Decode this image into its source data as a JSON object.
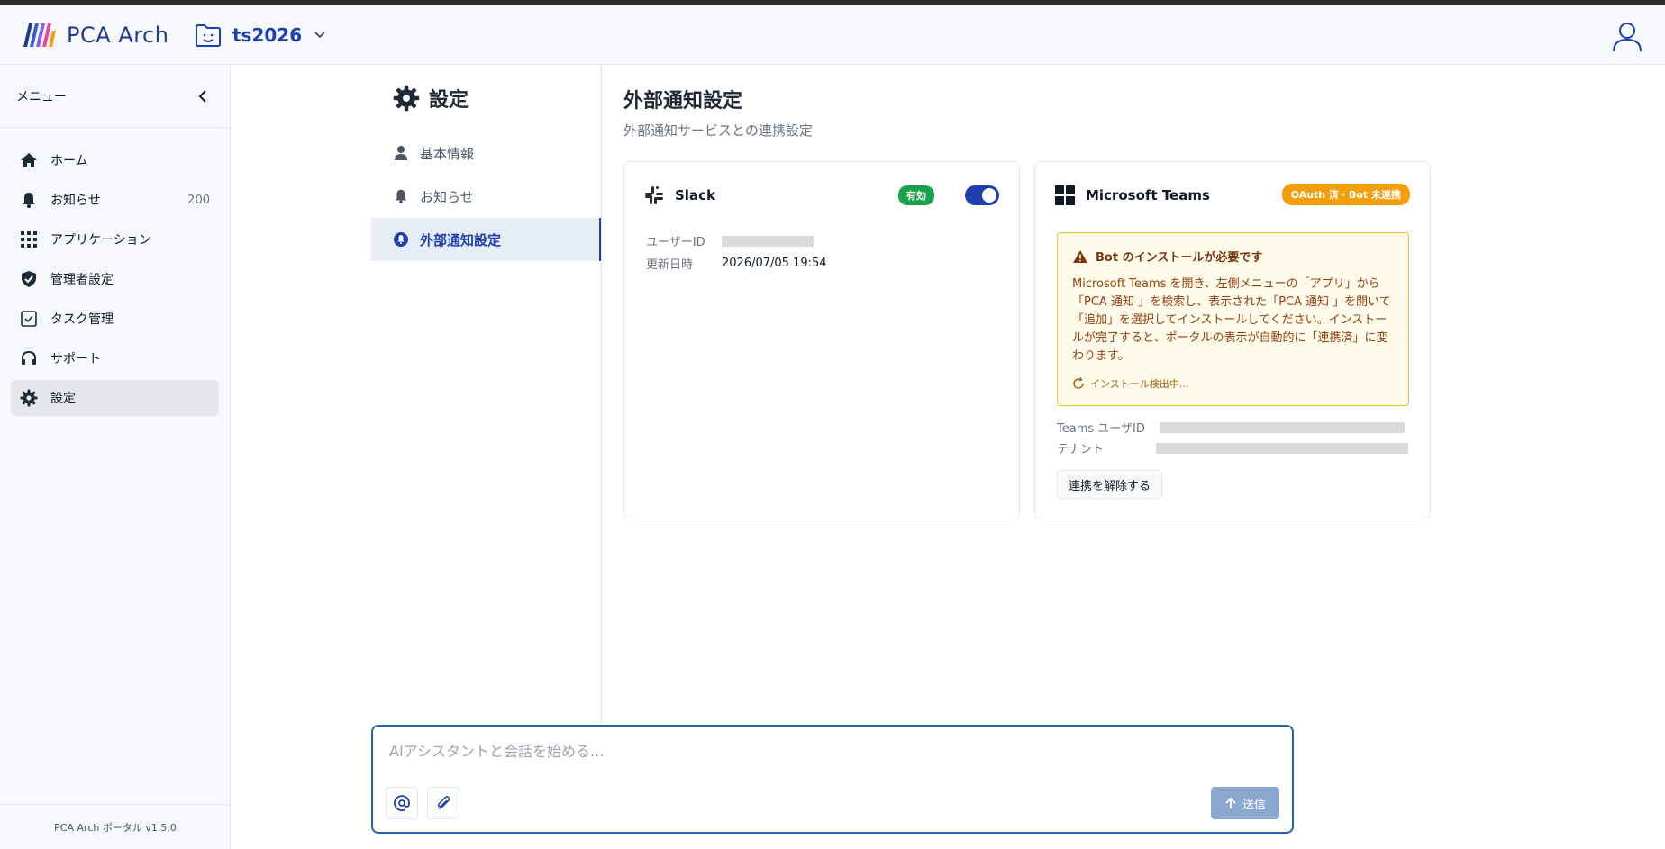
{
  "app": {
    "brand": "PCA Arch",
    "workspace": "ts2026",
    "version_label": "PCA Arch ポータル v1.5.0"
  },
  "sidebar": {
    "title": "メニュー",
    "items": [
      {
        "label": "ホーム",
        "icon": "home-icon"
      },
      {
        "label": "お知らせ",
        "icon": "bell-icon",
        "count": "200"
      },
      {
        "label": "アプリケーション",
        "icon": "grid-icon"
      },
      {
        "label": "管理者設定",
        "icon": "shield-icon"
      },
      {
        "label": "タスク管理",
        "icon": "checkbox-icon"
      },
      {
        "label": "サポート",
        "icon": "headset-icon"
      },
      {
        "label": "設定",
        "icon": "gear-icon",
        "active": true
      }
    ]
  },
  "settings_nav": {
    "title": "設定",
    "items": [
      {
        "label": "基本情報",
        "icon": "person-icon"
      },
      {
        "label": "お知らせ",
        "icon": "bell-icon"
      },
      {
        "label": "外部通知設定",
        "icon": "bell-circle-icon",
        "active": true
      }
    ]
  },
  "page": {
    "title": "外部通知設定",
    "subtitle": "外部通知サービスとの連携設定"
  },
  "slack": {
    "name": "Slack",
    "status_badge": "有効",
    "enabled": true,
    "user_id_label": "ユーザーID",
    "updated_label": "更新日時",
    "updated_value": "2026/07/05 19:54"
  },
  "teams": {
    "name": "Microsoft Teams",
    "status_badge": "OAuth 済・Bot 未連携",
    "warning_title": "Bot のインストールが必要です",
    "warning_body": "Microsoft Teams を開き、左側メニューの「アプリ」から「PCA 通知 」を検索し、表示された「PCA 通知 」を開いて「追加」を選択してインストールしてください。インストールが完了すると、ポータルの表示が自動的に「連携済」に変わります。",
    "detecting": "インストール検出中...",
    "user_id_label": "Teams ユーザID",
    "tenant_label": "テナント",
    "unlink_button": "連携を解除する"
  },
  "chat": {
    "placeholder": "AIアシスタントと会話を始める...",
    "send_label": "送信"
  },
  "colors": {
    "primary": "#1e40af",
    "enabled_badge": "#16a34a",
    "warning_badge": "#f59e0b",
    "warning_bg": "#fffbeb"
  }
}
